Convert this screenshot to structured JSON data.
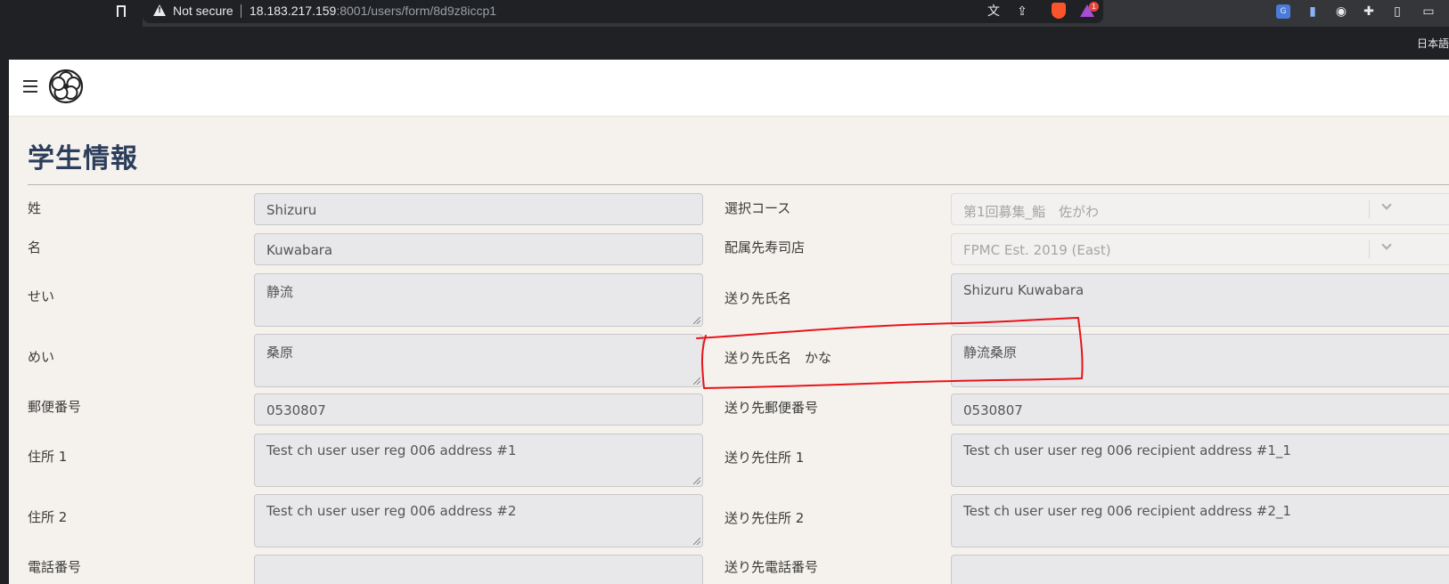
{
  "browser": {
    "security_label": "Not secure",
    "url_host": "18.183.217.159",
    "url_path": ":8001/users/form/8d9z8iccp1",
    "language_label": "日本語",
    "extension_badge": "1"
  },
  "page": {
    "title": "学生情報"
  },
  "form": {
    "left": [
      {
        "label": "姓",
        "value": "Shizuru"
      },
      {
        "label": "名",
        "value": "Kuwabara"
      },
      {
        "label": "せい",
        "value": "静流"
      },
      {
        "label": "めい",
        "value": "桑原"
      },
      {
        "label": "郵便番号",
        "value": "0530807"
      },
      {
        "label": "住所 1",
        "value": "Test ch user user reg 006 address #1"
      },
      {
        "label": "住所 2",
        "value": "Test ch user user reg 006 address #2"
      },
      {
        "label": "電話番号",
        "value": ""
      }
    ],
    "right": [
      {
        "label": "選択コース",
        "value": "第1回募集_鮨　佐がわ"
      },
      {
        "label": "配属先寿司店",
        "value": "FPMC Est. 2019 (East)"
      },
      {
        "label": "送り先氏名",
        "value": "Shizuru Kuwabara"
      },
      {
        "label": "送り先氏名　かな",
        "value": "静流桑原"
      },
      {
        "label": "送り先郵便番号",
        "value": "0530807"
      },
      {
        "label": "送り先住所 1",
        "value": "Test ch user user reg 006 recipient address #1_1"
      },
      {
        "label": "送り先住所 2",
        "value": "Test ch user user reg 006 recipient address #2_1"
      },
      {
        "label": "送り先電話番号",
        "value": ""
      }
    ]
  },
  "colors": {
    "title": "#2d3e5c",
    "annotation": "#e8141b",
    "page_bg": "#f5f2ed"
  }
}
